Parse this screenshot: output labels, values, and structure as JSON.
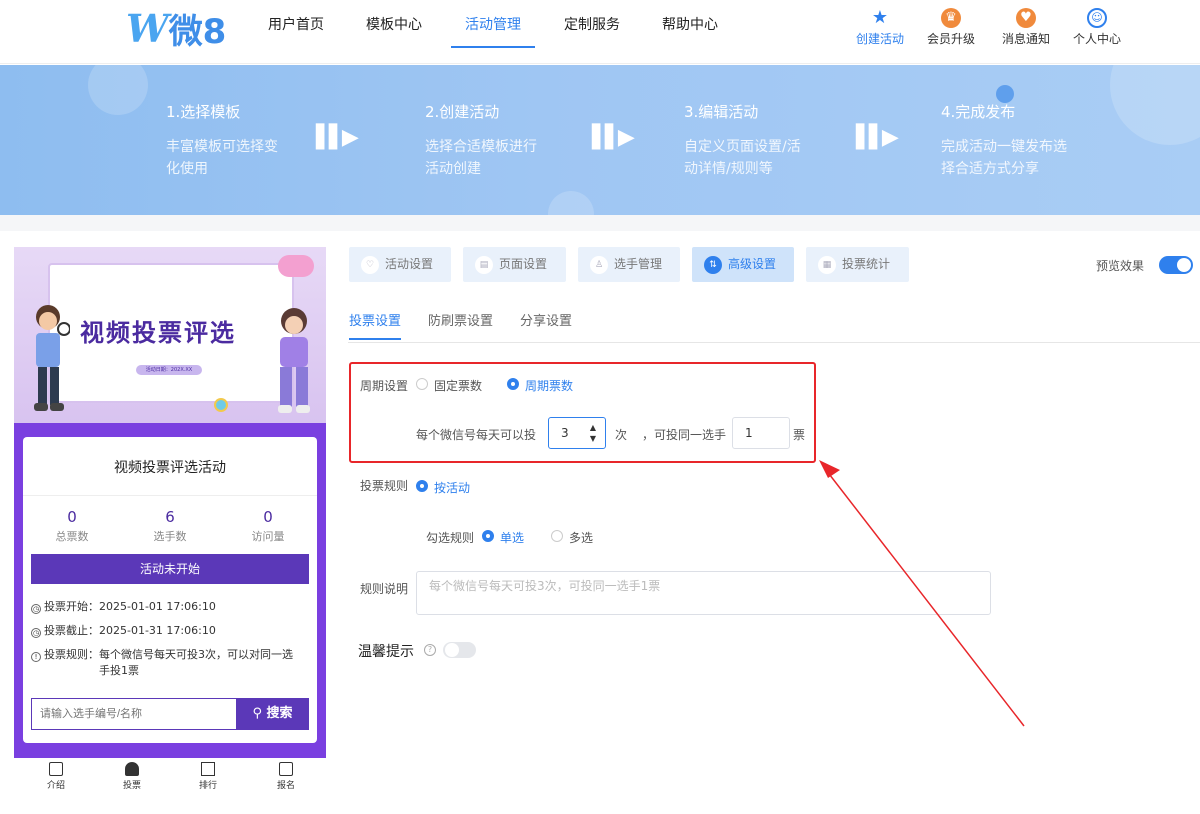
{
  "header": {
    "logo_text": "微8",
    "nav": [
      "用户首页",
      "模板中心",
      "活动管理",
      "定制服务",
      "帮助中心"
    ],
    "tools": [
      "创建活动",
      "会员升级",
      "消息通知",
      "个人中心"
    ]
  },
  "banner": {
    "steps": [
      {
        "title": "1.选择模板",
        "desc": "丰富模板可选择变化使用"
      },
      {
        "title": "2.创建活动",
        "desc": "选择合适模板进行活动创建"
      },
      {
        "title": "3.编辑活动",
        "desc": "自定义页面设置/活动详情/规则等"
      },
      {
        "title": "4.完成发布",
        "desc": "完成活动一键发布选择合适方式分享"
      }
    ]
  },
  "preview": {
    "poster_title": "视频投票评选",
    "poster_date": "活动日期：202X.XX",
    "activity_name": "视频投票评选活动",
    "stats": [
      {
        "value": "0",
        "label": "总票数"
      },
      {
        "value": "6",
        "label": "选手数"
      },
      {
        "value": "0",
        "label": "访问量"
      }
    ],
    "status_button": "活动未开始",
    "vote_start_label": "投票开始：",
    "vote_start": "2025-01-01 17:06:10",
    "vote_end_label": "投票截止：",
    "vote_end": "2025-01-31 17:06:10",
    "vote_rule_label": "投票规则：",
    "vote_rule": "每个微信号每天可投3次，可以对同一选手投1票",
    "search_placeholder": "请输入选手编号/名称",
    "search_button": "搜索",
    "tabbar": [
      "介绍",
      "投票",
      "排行",
      "报名"
    ]
  },
  "panel": {
    "tabs": [
      "活动设置",
      "页面设置",
      "选手管理",
      "高级设置",
      "投票统计"
    ],
    "preview_label": "预览效果",
    "preview_on": true,
    "subtabs": [
      "投票设置",
      "防刷票设置",
      "分享设置"
    ],
    "cycle_label": "周期设置",
    "cycle_options": [
      "固定票数",
      "周期票数"
    ],
    "cycle_selected": "周期票数",
    "per_day_prefix": "每个微信号每天可以投",
    "per_day_value": "3",
    "per_day_unit": "次",
    "same_player_prefix": "，可投同一选手",
    "same_player_value": "1",
    "same_player_unit": "票",
    "rule_label": "投票规则",
    "rule_option": "按活动",
    "check_label": "勾选规则",
    "check_options": [
      "单选",
      "多选"
    ],
    "check_selected": "单选",
    "desc_label": "规则说明",
    "desc_placeholder": "每个微信号每天可投3次，可投同一选手1票",
    "tip_label": "温馨提示",
    "tip_on": false
  },
  "colors": {
    "accent": "#2f80ed",
    "purple": "#5b38b8",
    "highlight_red": "#e8262a"
  }
}
